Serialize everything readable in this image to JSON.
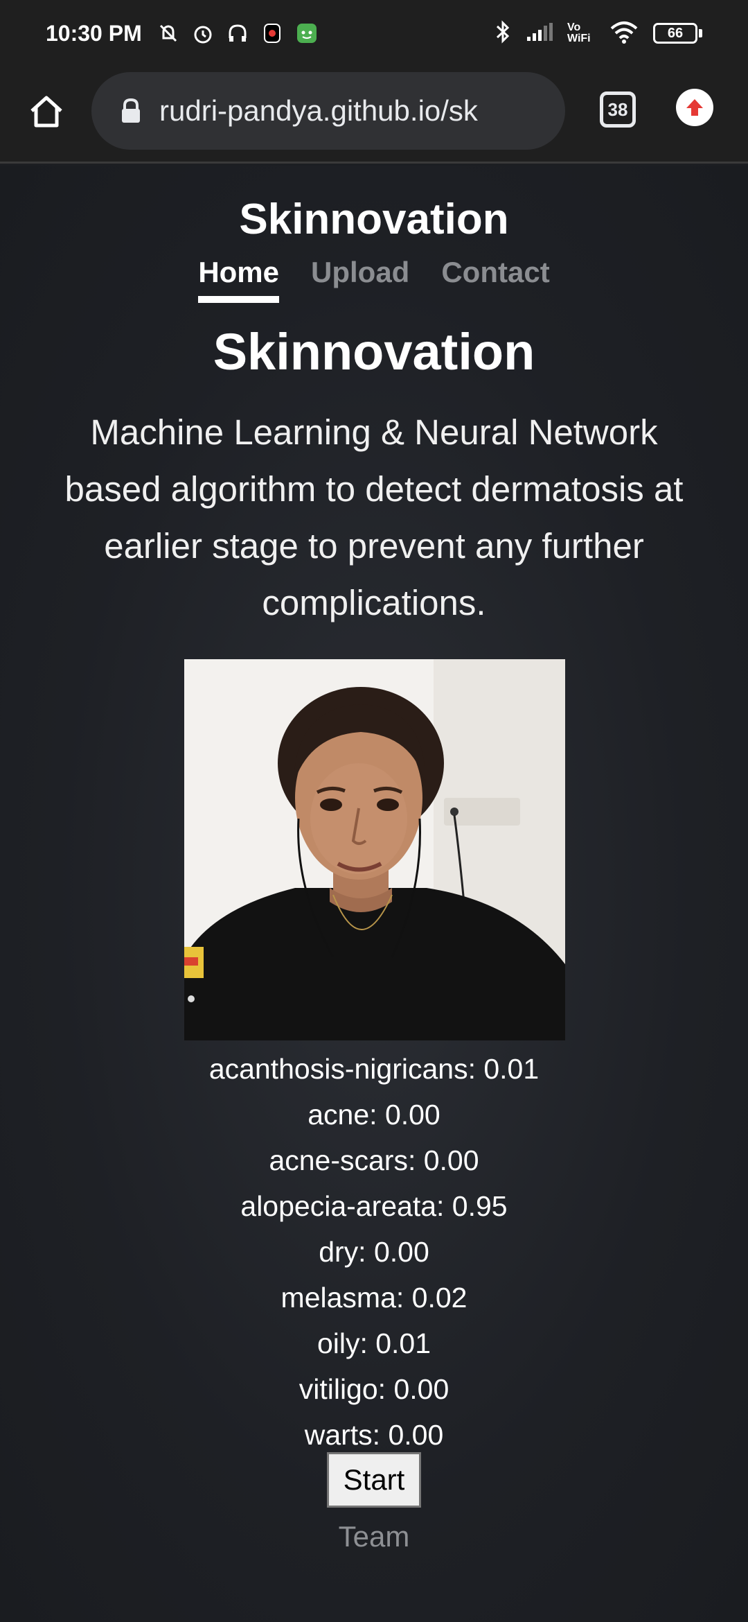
{
  "status_bar": {
    "time": "10:30 PM",
    "battery": "66",
    "volte": "Vo WiFi"
  },
  "browser": {
    "url": "rudri-pandya.github.io/sk",
    "tab_count": "38"
  },
  "site": {
    "brand": "Skinnovation",
    "nav": [
      "Home",
      "Upload",
      "Contact"
    ],
    "active_nav": "Home",
    "hero_title": "Skinnovation",
    "lead": "Machine Learning & Neural Network based algorithm to detect dermatosis at earlier stage to prevent any further complications.",
    "predictions": [
      "acanthosis-nigricans: 0.01",
      "acne: 0.00",
      "acne-scars: 0.00",
      "alopecia-areata: 0.95",
      "dry: 0.00",
      "melasma: 0.02",
      "oily: 0.01",
      "vitiligo: 0.00",
      "warts: 0.00"
    ],
    "start_label": "Start",
    "team_label": "Team"
  }
}
